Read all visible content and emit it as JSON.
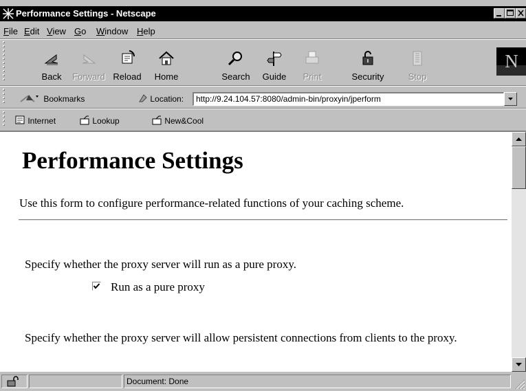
{
  "window": {
    "title": "Performance Settings - Netscape"
  },
  "menu": [
    "File",
    "Edit",
    "View",
    "Go",
    "Window",
    "Help"
  ],
  "toolbar": {
    "buttons": [
      {
        "label": "Back",
        "icon": "back-arrow-icon",
        "enabled": true
      },
      {
        "label": "Forward",
        "icon": "forward-arrow-icon",
        "enabled": false
      },
      {
        "label": "Reload",
        "icon": "reload-icon",
        "enabled": true
      },
      {
        "label": "Home",
        "icon": "home-icon",
        "enabled": true
      },
      {
        "label": "Search",
        "icon": "search-icon",
        "enabled": true
      },
      {
        "label": "Guide",
        "icon": "guide-icon",
        "enabled": true
      },
      {
        "label": "Print",
        "icon": "print-icon",
        "enabled": false
      },
      {
        "label": "Security",
        "icon": "lock-icon",
        "enabled": true
      },
      {
        "label": "Stop",
        "icon": "stop-icon",
        "enabled": false
      }
    ],
    "logo": "N"
  },
  "location_bar": {
    "bookmarks_label": "Bookmarks",
    "location_label": "Location:",
    "url": "http://9.24.104.57:8080/admin-bin/proxyin/jperform"
  },
  "personal_toolbar": {
    "items": [
      "Internet",
      "Lookup",
      "New&Cool"
    ]
  },
  "page": {
    "heading": "Performance Settings",
    "intro": "Use this form to configure performance-related functions of your caching scheme.",
    "pure_proxy_question": "Specify whether the proxy server will run as a pure proxy.",
    "pure_proxy_checkbox_label": "Run as a pure proxy",
    "pure_proxy_checked": true,
    "persistent_question": "Specify whether the proxy server will allow persistent connections from clients to the proxy."
  },
  "status": {
    "text": "Document: Done"
  },
  "colors": {
    "chrome": "#c0c0c0",
    "titlebar": "#000000",
    "content_bg": "#ffffff"
  }
}
